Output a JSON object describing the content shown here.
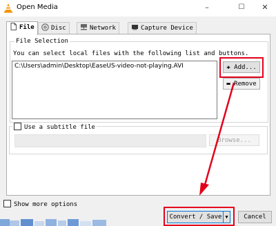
{
  "window": {
    "title": "Open Media",
    "minimize": "–",
    "maximize": "☐",
    "close": "✕"
  },
  "tabs": [
    {
      "label": "File",
      "active": true,
      "icon": "file-icon"
    },
    {
      "label": "Disc",
      "active": false,
      "icon": "disc-icon"
    },
    {
      "label": "Network",
      "active": false,
      "icon": "network-icon"
    },
    {
      "label": "Capture Device",
      "active": false,
      "icon": "capture-device-icon"
    }
  ],
  "file_selection": {
    "title": "File Selection",
    "description": "You can select local files with the following list and buttons.",
    "files": [
      "C:\\Users\\admin\\Desktop\\EaseUS-video-not-playing.AVI"
    ],
    "add_label": "Add...",
    "remove_label": "Remove"
  },
  "subtitle": {
    "checkbox_label": "Use a subtitle file",
    "checked": false,
    "browse_label": "Browse..."
  },
  "footer": {
    "more_options_label": "Show more options",
    "convert_label": "Convert / Save",
    "cancel_label": "Cancel"
  },
  "colors": {
    "annotation": "#e3001b",
    "accent": "#0078d7"
  }
}
